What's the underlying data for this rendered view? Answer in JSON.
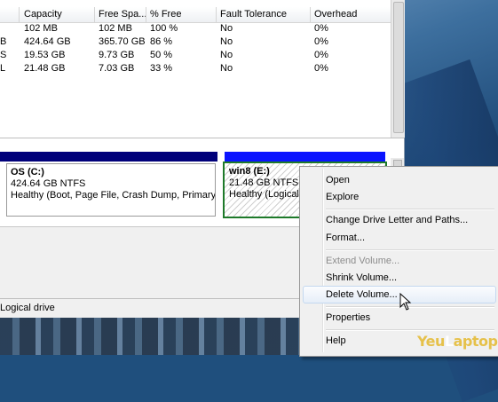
{
  "table": {
    "columns": [
      "Capacity",
      "Free Spa...",
      "% Free",
      "Fault Tolerance",
      "Overhead"
    ],
    "rows": [
      {
        "prefix": "",
        "capacity": "102 MB",
        "free": "102 MB",
        "pct": "100 %",
        "fault": "No",
        "overhead": "0%"
      },
      {
        "prefix": "B",
        "capacity": "424.64 GB",
        "free": "365.70 GB",
        "pct": "86 %",
        "fault": "No",
        "overhead": "0%"
      },
      {
        "prefix": "S",
        "capacity": "19.53 GB",
        "free": "9.73 GB",
        "pct": "50 %",
        "fault": "No",
        "overhead": "0%"
      },
      {
        "prefix": "L",
        "capacity": "21.48 GB",
        "free": "7.03 GB",
        "pct": "33 %",
        "fault": "No",
        "overhead": "0%"
      }
    ]
  },
  "disk": {
    "partition_c": {
      "title": "OS  (C:)",
      "size": "424.64 GB NTFS",
      "status": "Healthy (Boot, Page File, Crash Dump, Primary Par"
    },
    "partition_e": {
      "title": "win8  (E:)",
      "size": "21.48 GB NTFS",
      "status": "Healthy (Logical"
    }
  },
  "status_bar": {
    "legend": "Logical drive"
  },
  "context_menu": {
    "items": [
      {
        "label": "Open",
        "enabled": true
      },
      {
        "label": "Explore",
        "enabled": true
      },
      {
        "label": "Change Drive Letter and Paths...",
        "enabled": true
      },
      {
        "label": "Format...",
        "enabled": true
      },
      {
        "label": "Extend Volume...",
        "enabled": false
      },
      {
        "label": "Shrink Volume...",
        "enabled": true
      },
      {
        "label": "Delete Volume...",
        "enabled": true,
        "hovered": true
      },
      {
        "label": "Properties",
        "enabled": true
      },
      {
        "label": "Help",
        "enabled": true
      }
    ]
  },
  "watermark": {
    "brand": "YeuLaptop"
  },
  "colors": {
    "primary_bar": "#00007a",
    "logical_bar": "#0a14ff",
    "selected_border": "#1e7a2a",
    "menu_hover": "#c4d8ef"
  }
}
